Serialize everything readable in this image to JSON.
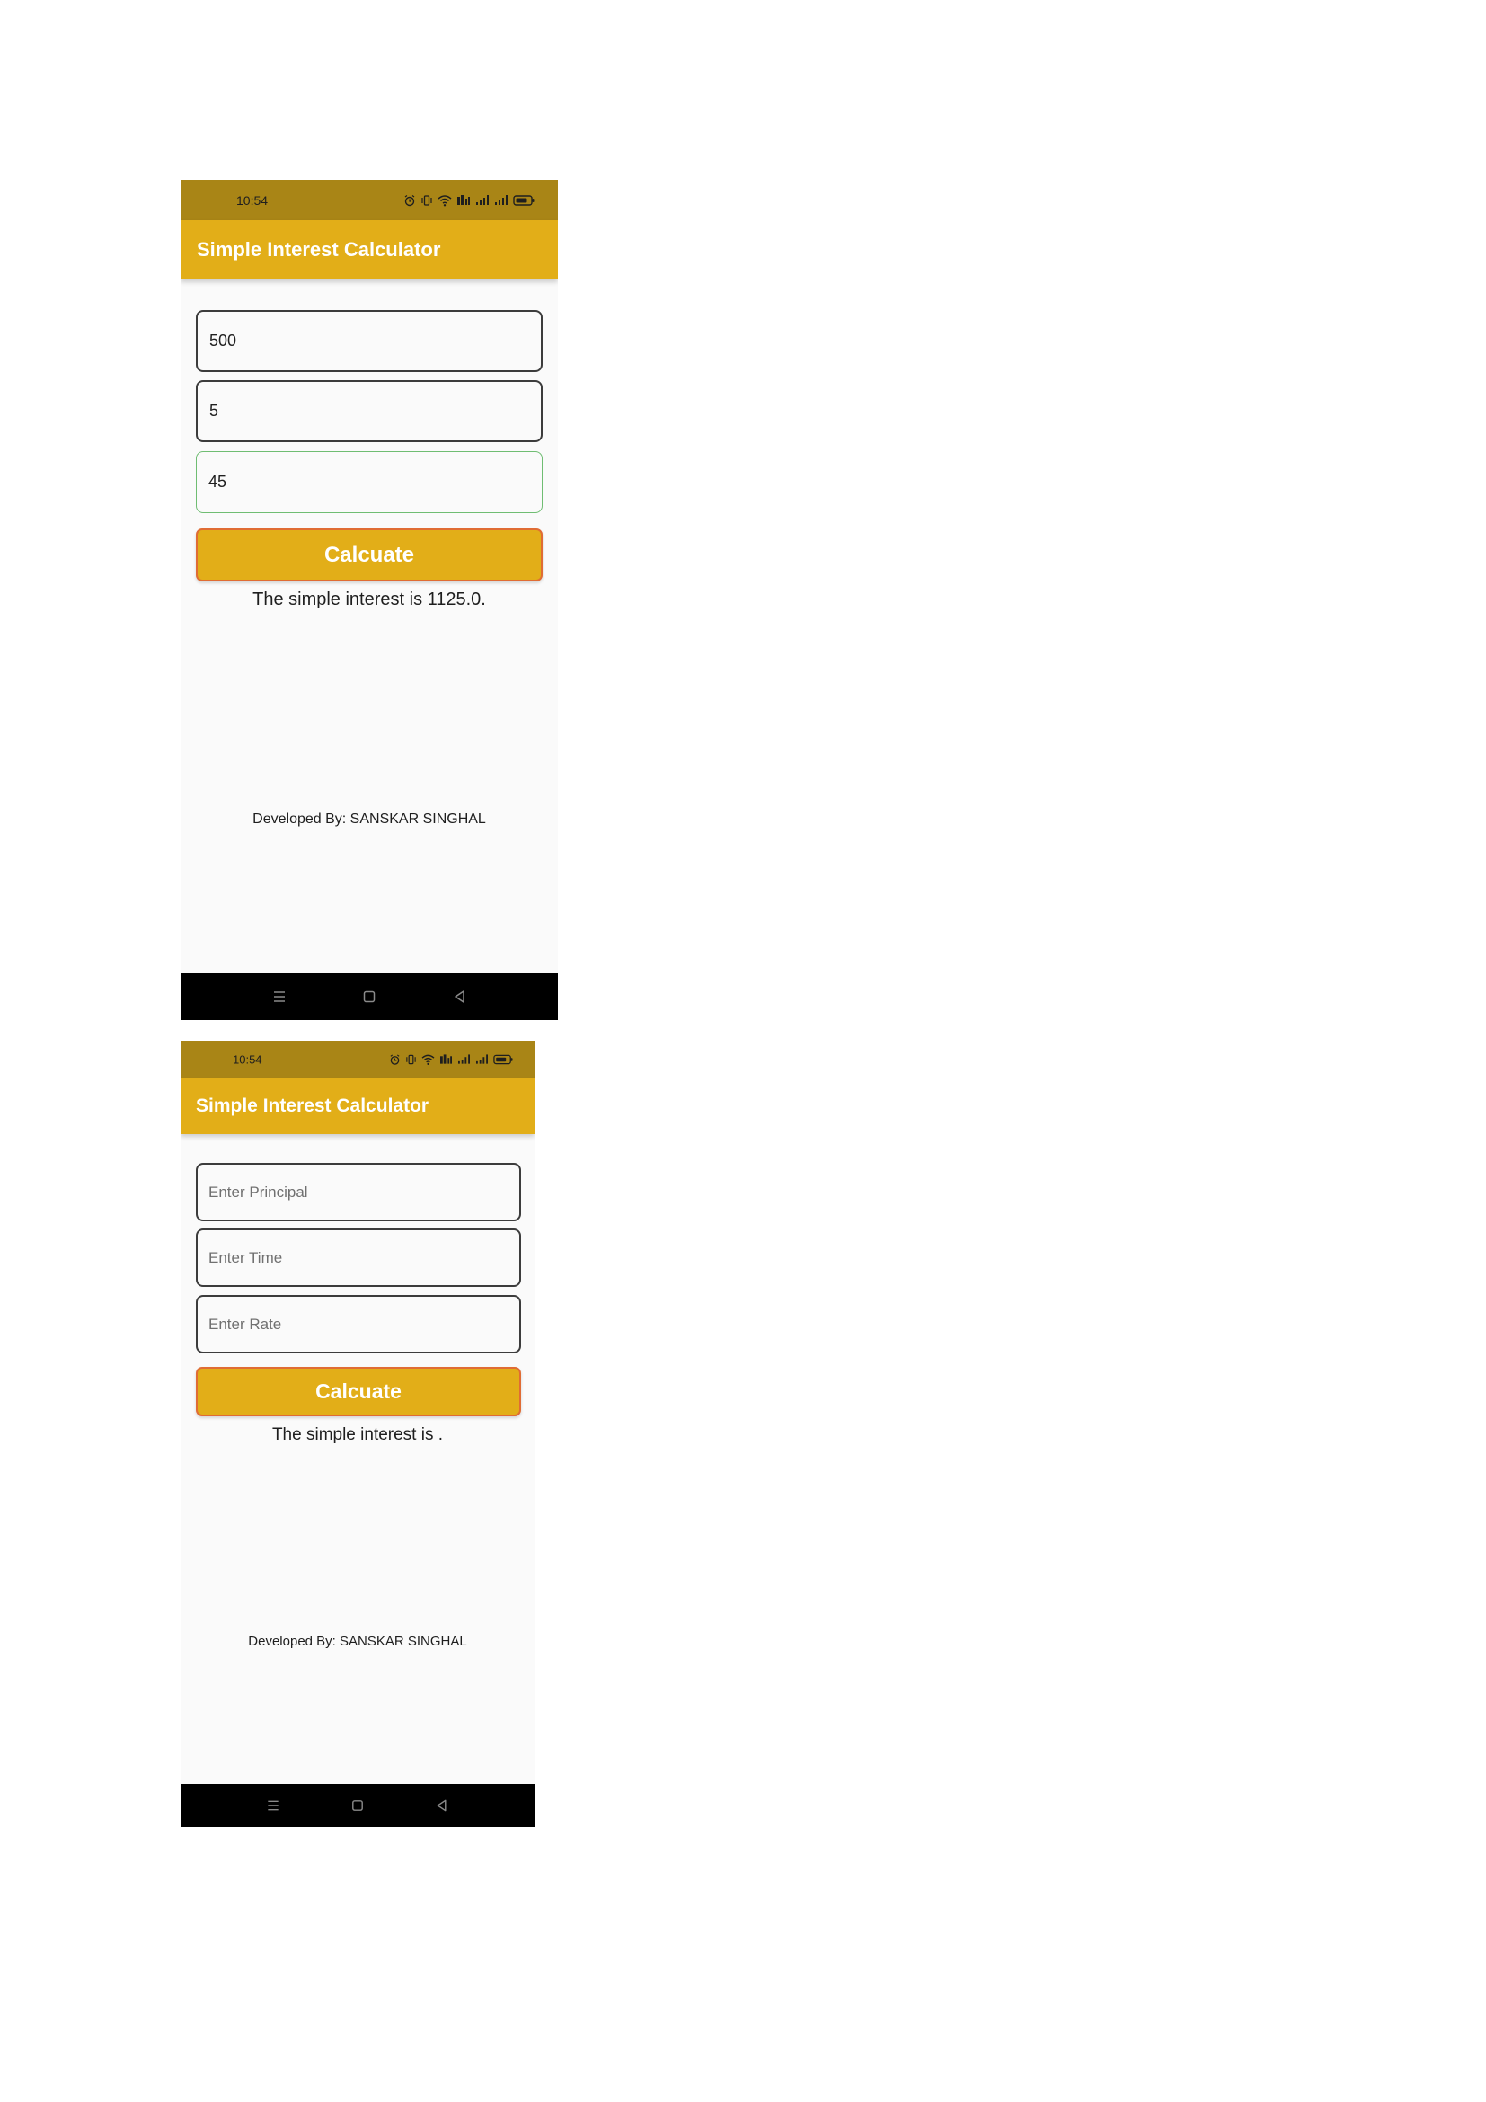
{
  "screens": [
    {
      "status_time": "10:54",
      "app_title": "Simple Interest Calculator",
      "fields": [
        {
          "value": "500",
          "placeholder": "Enter Principal"
        },
        {
          "value": "5",
          "placeholder": "Enter Time"
        },
        {
          "value": "45",
          "placeholder": "Enter Rate"
        }
      ],
      "button_label": "Calcuate",
      "result_text": "The simple interest is 1125.0.",
      "developer_text": "Developed By: SANSKAR SINGHAL"
    },
    {
      "status_time": "10:54",
      "app_title": "Simple Interest Calculator",
      "fields": [
        {
          "value": "",
          "placeholder": "Enter Principal"
        },
        {
          "value": "",
          "placeholder": "Enter Time"
        },
        {
          "value": "",
          "placeholder": "Enter Rate"
        }
      ],
      "button_label": "Calcuate",
      "result_text": "The simple interest is .",
      "developer_text": "Developed By: SANSKAR SINGHAL"
    }
  ],
  "colors": {
    "status_bar": "#a98516",
    "app_bar": "#e2ae18",
    "button_border": "#e06c34",
    "focused_border": "#6fbd72",
    "screen_background": "#fafafa"
  },
  "icons": {
    "status_bar": [
      "alarm-icon",
      "vibrate-icon",
      "wifi-icon",
      "data-icon",
      "signal-icon",
      "signal-icon",
      "battery-icon"
    ],
    "nav_bar": [
      "menu-icon",
      "home-icon",
      "back-icon"
    ]
  }
}
